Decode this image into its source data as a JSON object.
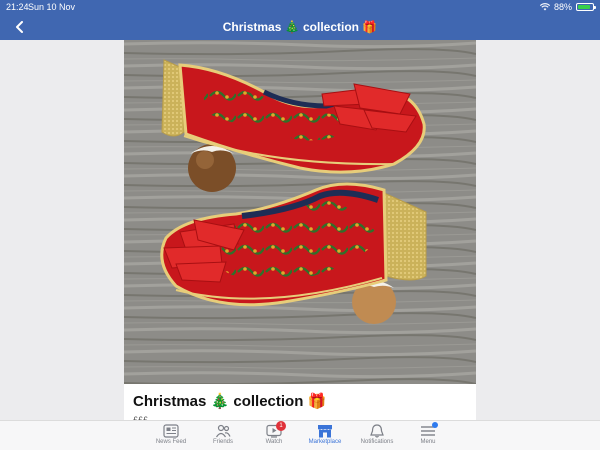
{
  "status_bar": {
    "time": "21:24",
    "date": "Sun 10 Nov",
    "battery": "88%",
    "battery_level": 0.88
  },
  "nav": {
    "title": "Christmas 🎄 collection 🎁"
  },
  "post": {
    "title": "Christmas 🎄 collection 🎁",
    "price": "£££"
  },
  "tabs": [
    {
      "label": "News Feed",
      "icon": "news-feed-icon"
    },
    {
      "label": "Friends",
      "icon": "friends-icon"
    },
    {
      "label": "Watch",
      "icon": "watch-icon",
      "badge": "1"
    },
    {
      "label": "Marketplace",
      "icon": "marketplace-icon",
      "active": true
    },
    {
      "label": "Notifications",
      "icon": "bell-icon"
    },
    {
      "label": "Menu",
      "icon": "menu-icon"
    }
  ],
  "colors": {
    "header": "#4067b1",
    "active_tab": "#3b74d8",
    "badge": "#e0323a"
  }
}
